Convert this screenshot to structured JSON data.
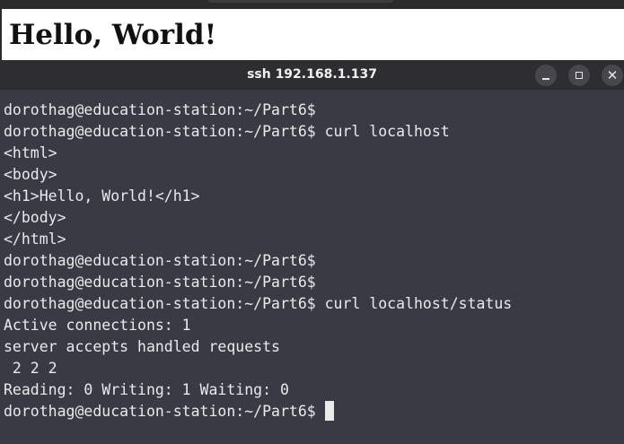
{
  "browser": {
    "heading": "Hello, World!"
  },
  "terminal": {
    "title": "ssh 192.168.1.137",
    "lines": [
      "dorothag@education-station:~/Part6$",
      "dorothag@education-station:~/Part6$ curl localhost",
      "<html>",
      "<body>",
      "<h1>Hello, World!</h1>",
      "</body>",
      "</html>",
      "dorothag@education-station:~/Part6$",
      "dorothag@education-station:~/Part6$",
      "dorothag@education-station:~/Part6$ curl localhost/status",
      "Active connections: 1",
      "server accepts handled requests",
      " 2 2 2",
      "Reading: 0 Writing: 1 Waiting: 0",
      "dorothag@education-station:~/Part6$ "
    ]
  },
  "icons": {
    "minimize": "minimize-icon",
    "maximize": "maximize-icon",
    "close": "close-icon"
  }
}
